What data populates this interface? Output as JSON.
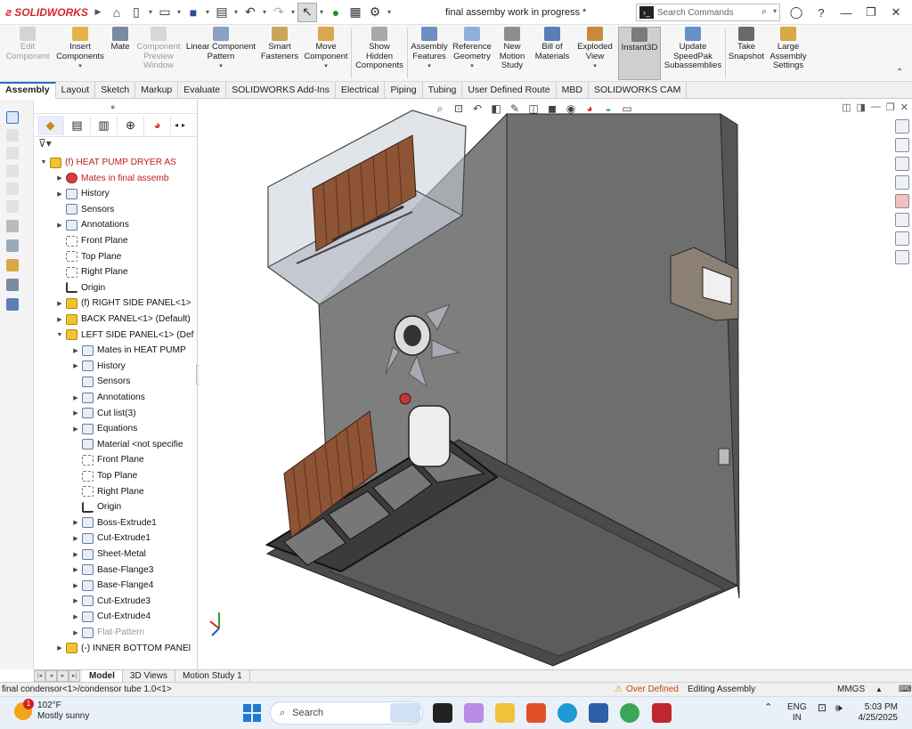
{
  "app": {
    "brand": "SOLIDWORKS",
    "doc_title": "final assemby work in progress *",
    "search_placeholder": "Search Commands"
  },
  "commands": [
    {
      "label": "Edit\nComponent",
      "state": "disabled"
    },
    {
      "label": "Insert\nComponents",
      "state": "normal"
    },
    {
      "label": "Mate",
      "state": "normal"
    },
    {
      "label": "Component\nPreview\nWindow",
      "state": "disabled"
    },
    {
      "label": "Linear Component\nPattern",
      "state": "normal"
    },
    {
      "label": "Smart\nFasteners",
      "state": "normal"
    },
    {
      "label": "Move\nComponent",
      "state": "normal"
    },
    {
      "label": "Show\nHidden\nComponents",
      "state": "normal"
    },
    {
      "label": "Assembly\nFeatures",
      "state": "normal"
    },
    {
      "label": "Reference\nGeometry",
      "state": "normal"
    },
    {
      "label": "New\nMotion\nStudy",
      "state": "normal"
    },
    {
      "label": "Bill of\nMaterials",
      "state": "normal"
    },
    {
      "label": "Exploded\nView",
      "state": "normal"
    },
    {
      "label": "Instant3D",
      "state": "active"
    },
    {
      "label": "Update\nSpeedPak\nSubassemblies",
      "state": "normal"
    },
    {
      "label": "Take\nSnapshot",
      "state": "normal"
    },
    {
      "label": "Large\nAssembly\nSettings",
      "state": "normal"
    }
  ],
  "tabs": [
    "Assembly",
    "Layout",
    "Sketch",
    "Markup",
    "Evaluate",
    "SOLIDWORKS Add-Ins",
    "Electrical",
    "Piping",
    "Tubing",
    "User Defined Route",
    "MBD",
    "SOLIDWORKS CAM"
  ],
  "active_tab": "Assembly",
  "tree": [
    {
      "label": "(f) HEAT PUMP DRYER AS",
      "indent": 0,
      "exp": "down",
      "icon": "yellow",
      "color": "red"
    },
    {
      "label": "Mates in final assemb",
      "indent": 1,
      "exp": "right",
      "icon": "red",
      "color": "red"
    },
    {
      "label": "History",
      "indent": 1,
      "exp": "right",
      "icon": "normal",
      "color": ""
    },
    {
      "label": "Sensors",
      "indent": 1,
      "exp": "",
      "icon": "normal",
      "color": ""
    },
    {
      "label": "Annotations",
      "indent": 1,
      "exp": "right",
      "icon": "normal",
      "color": ""
    },
    {
      "label": "Front Plane",
      "indent": 1,
      "exp": "",
      "icon": "plane",
      "color": ""
    },
    {
      "label": "Top Plane",
      "indent": 1,
      "exp": "",
      "icon": "plane",
      "color": ""
    },
    {
      "label": "Right Plane",
      "indent": 1,
      "exp": "",
      "icon": "plane",
      "color": ""
    },
    {
      "label": "Origin",
      "indent": 1,
      "exp": "",
      "icon": "origin",
      "color": ""
    },
    {
      "label": "(f) RIGHT SIDE PANEL<1>",
      "indent": 1,
      "exp": "right",
      "icon": "yellow",
      "color": ""
    },
    {
      "label": "BACK PANEL<1> (Default)",
      "indent": 1,
      "exp": "right",
      "icon": "yellow",
      "color": ""
    },
    {
      "label": "LEFT SIDE PANEL<1> (Def",
      "indent": 1,
      "exp": "down",
      "icon": "yellow",
      "color": ""
    },
    {
      "label": "Mates in HEAT PUMP",
      "indent": 2,
      "exp": "right",
      "icon": "normal",
      "color": ""
    },
    {
      "label": "History",
      "indent": 2,
      "exp": "right",
      "icon": "normal",
      "color": ""
    },
    {
      "label": "Sensors",
      "indent": 2,
      "exp": "",
      "icon": "normal",
      "color": ""
    },
    {
      "label": "Annotations",
      "indent": 2,
      "exp": "right",
      "icon": "normal",
      "color": ""
    },
    {
      "label": "Cut list(3)",
      "indent": 2,
      "exp": "right",
      "icon": "normal",
      "color": ""
    },
    {
      "label": "Equations",
      "indent": 2,
      "exp": "right",
      "icon": "normal",
      "color": ""
    },
    {
      "label": "Material <not specifie",
      "indent": 2,
      "exp": "",
      "icon": "normal",
      "color": ""
    },
    {
      "label": "Front Plane",
      "indent": 2,
      "exp": "",
      "icon": "plane",
      "color": ""
    },
    {
      "label": "Top Plane",
      "indent": 2,
      "exp": "",
      "icon": "plane",
      "color": ""
    },
    {
      "label": "Right Plane",
      "indent": 2,
      "exp": "",
      "icon": "plane",
      "color": ""
    },
    {
      "label": "Origin",
      "indent": 2,
      "exp": "",
      "icon": "origin",
      "color": ""
    },
    {
      "label": "Boss-Extrude1",
      "indent": 2,
      "exp": "right",
      "icon": "normal",
      "color": ""
    },
    {
      "label": "Cut-Extrude1",
      "indent": 2,
      "exp": "right",
      "icon": "normal",
      "color": ""
    },
    {
      "label": "Sheet-Metal",
      "indent": 2,
      "exp": "right",
      "icon": "normal",
      "color": ""
    },
    {
      "label": "Base-Flange3",
      "indent": 2,
      "exp": "right",
      "icon": "normal",
      "color": ""
    },
    {
      "label": "Base-Flange4",
      "indent": 2,
      "exp": "right",
      "icon": "normal",
      "color": ""
    },
    {
      "label": "Cut-Extrude3",
      "indent": 2,
      "exp": "right",
      "icon": "normal",
      "color": ""
    },
    {
      "label": "Cut-Extrude4",
      "indent": 2,
      "exp": "right",
      "icon": "normal",
      "color": ""
    },
    {
      "label": "Flat-Pattern",
      "indent": 2,
      "exp": "right",
      "icon": "normal",
      "color": "grey"
    },
    {
      "label": "(-) INNER BOTTOM PANEl",
      "indent": 1,
      "exp": "right",
      "icon": "yellow",
      "color": ""
    }
  ],
  "model_tabs": [
    "Model",
    "3D Views",
    "Motion Study 1"
  ],
  "status": {
    "selection": "final condensor<1>/condensor tube 1.0<1>",
    "warning": "Over Defined",
    "mode": "Editing Assembly",
    "units": "MMGS",
    "units_arrow": "▲"
  },
  "taskbar": {
    "temp": "102°F",
    "weather": "Mostly sunny",
    "badge": "1",
    "search": "Search",
    "lang1": "ENG",
    "lang2": "IN",
    "time": "5:03 PM",
    "date": "4/25/2025"
  },
  "colors": {
    "accent": "#d22630",
    "box": "#6f6f6f",
    "copper": "#9b5a3a"
  }
}
